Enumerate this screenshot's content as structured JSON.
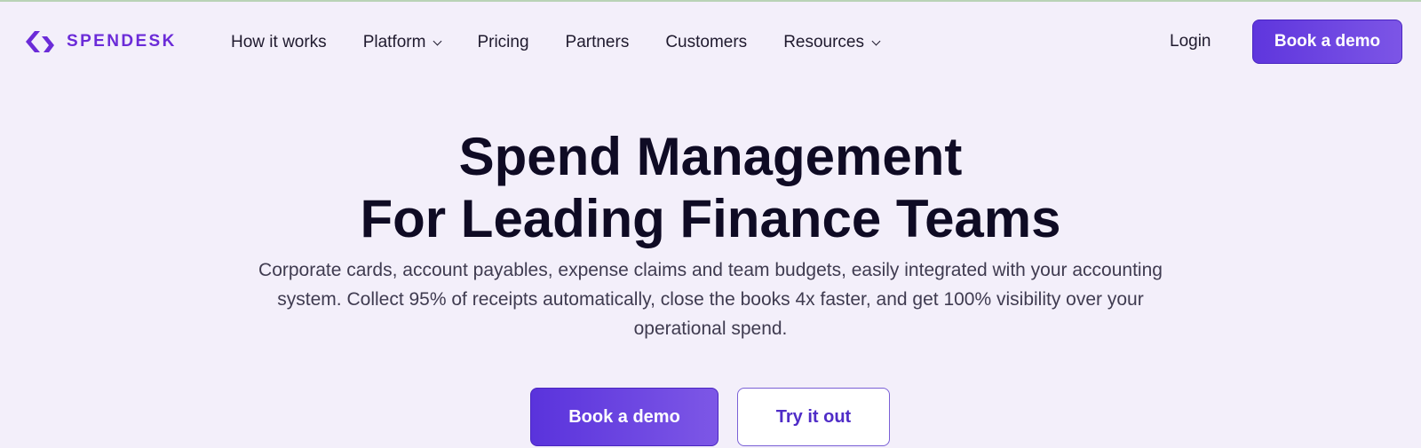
{
  "colors": {
    "background": "#f3effa",
    "brand": "#6b2bd8",
    "primary_button": "#5f36dd",
    "heading": "#0f0b24",
    "body_text": "#3f3b50"
  },
  "header": {
    "logo_text": "SPENDESK",
    "logo_icon": "spendesk-logo-icon",
    "nav": [
      {
        "label": "How it works",
        "has_dropdown": false
      },
      {
        "label": "Platform",
        "has_dropdown": true
      },
      {
        "label": "Pricing",
        "has_dropdown": false
      },
      {
        "label": "Partners",
        "has_dropdown": false
      },
      {
        "label": "Customers",
        "has_dropdown": false
      },
      {
        "label": "Resources",
        "has_dropdown": true
      }
    ],
    "login_label": "Login",
    "cta_label": "Book a demo"
  },
  "hero": {
    "title_line1": "Spend Management",
    "title_line2": "For Leading Finance Teams",
    "subtitle": "Corporate cards, account payables, expense claims and team budgets, easily integrated with your accounting system. Collect 95% of receipts automatically, close the books 4x faster, and get 100% visibility over your operational spend.",
    "primary_cta": "Book a demo",
    "secondary_cta": "Try it out"
  }
}
